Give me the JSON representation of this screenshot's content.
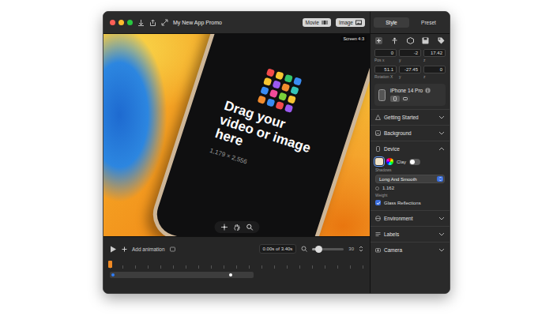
{
  "window": {
    "title": "My New App Promo"
  },
  "mode_buttons": [
    {
      "label": "Movie",
      "kind": "movie"
    },
    {
      "label": "Image",
      "kind": "image"
    }
  ],
  "sidebar_tabs": [
    {
      "label": "Style",
      "selected": true
    },
    {
      "label": "Preset",
      "selected": false
    }
  ],
  "canvas": {
    "screen_label": "Screen 4:3",
    "drop_text": "Drag your video or image here",
    "dimensions": "1,179 × 2,556"
  },
  "timeline": {
    "add_label": "Add animation",
    "time": "0.00s of 3.40s",
    "zoom_level": 0.2,
    "zoom_label": "30",
    "playhead_level": 0,
    "keyframes": [
      {
        "level": 0.02,
        "color": "#2f7cf6"
      },
      {
        "level": 0.84,
        "color": "#ffffff"
      }
    ]
  },
  "transform": [
    [
      {
        "value": "0",
        "label": "Pos x"
      },
      {
        "value": "-2",
        "label": "y"
      },
      {
        "value": "17.42",
        "label": "z"
      }
    ],
    [
      {
        "value": "51.1",
        "label": "Rotation X"
      },
      {
        "value": "-27.45",
        "label": "y"
      },
      {
        "value": "0",
        "label": "z"
      }
    ]
  ],
  "device": {
    "name": "iPhone 14 Pro",
    "orientations": [
      {
        "kind": "portrait",
        "selected": true
      },
      {
        "kind": "landscape",
        "selected": false
      }
    ]
  },
  "sections": [
    {
      "title": "Getting Started",
      "expanded": false
    },
    {
      "title": "Background",
      "expanded": false
    },
    {
      "title": "Device",
      "expanded": true
    },
    {
      "title": "Environment",
      "expanded": false
    },
    {
      "title": "Labels",
      "expanded": false
    },
    {
      "title": "Camera",
      "expanded": false
    }
  ],
  "device_style": {
    "swatches": [
      {
        "kind": "solid",
        "color": "#efe2c8",
        "selected": true
      },
      {
        "kind": "picker",
        "selected": false
      }
    ],
    "clay_label": "Clay",
    "clay_on": false,
    "shadows_label": "Shadows",
    "shadows_value": "Long And Smooth",
    "weight_value": "1.162",
    "weight_label": "Weight",
    "glass_label": "Glass Reflections",
    "glass_checked": true
  }
}
